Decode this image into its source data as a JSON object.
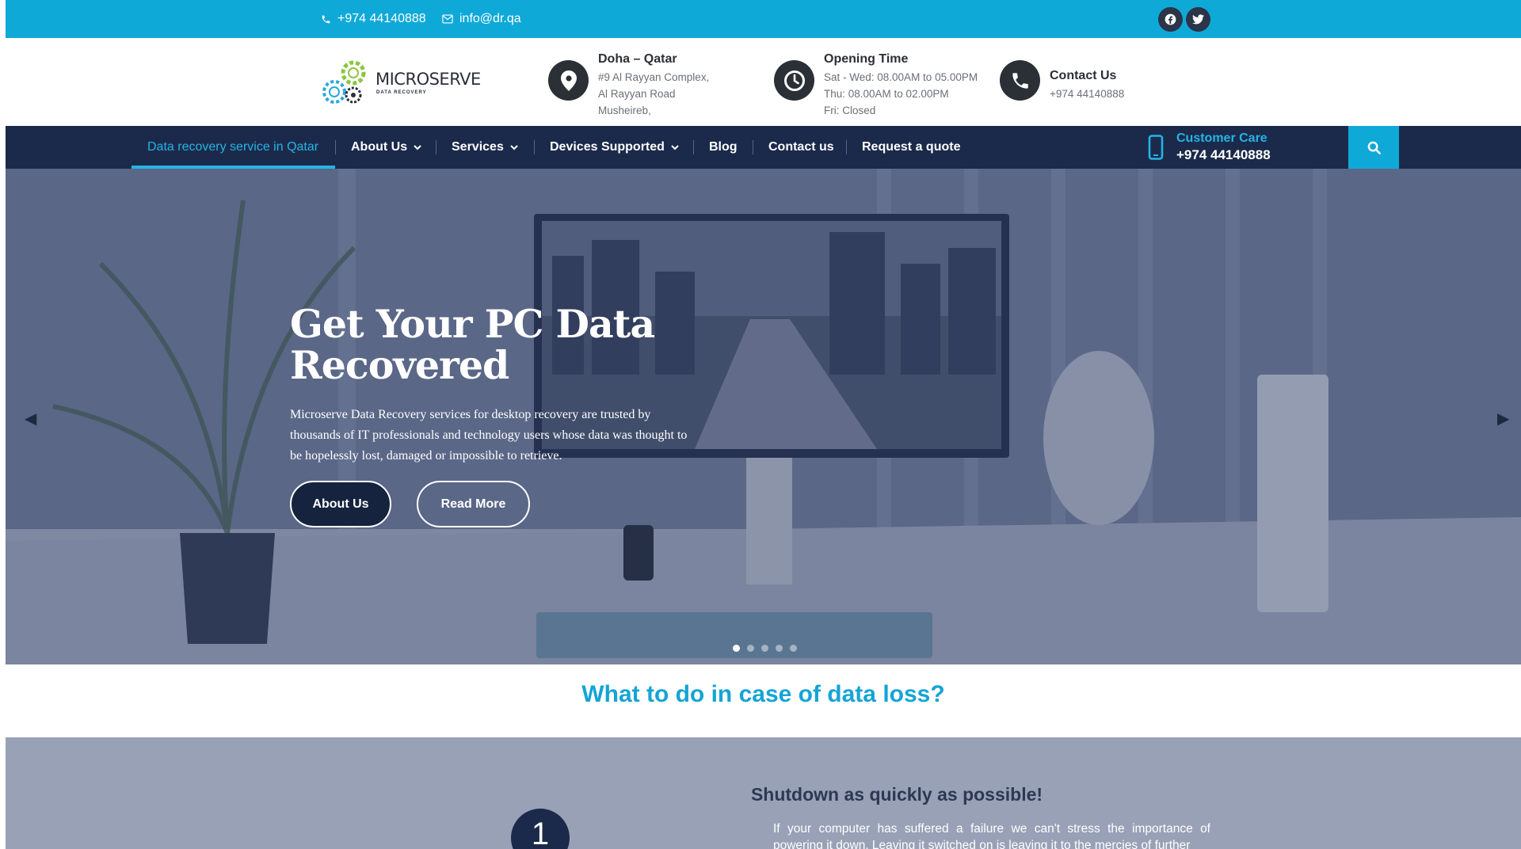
{
  "topbar": {
    "phone": "+974 44140888",
    "email": "info@dr.qa",
    "social": [
      "facebook-icon",
      "twitter-icon"
    ]
  },
  "header": {
    "logo_text": "MICROSERVE",
    "logo_sub": "DATA RECOVERY",
    "location": {
      "title": "Doha – Qatar",
      "line1": "#9 Al Rayyan Complex,",
      "line2": "Al Rayyan Road",
      "line3": "Musheireb,"
    },
    "hours": {
      "title": "Opening Time",
      "line1": "Sat - Wed: 08.00AM to 05.00PM",
      "line2": "Thu: 08.00AM to 02.00PM",
      "line3": "Fri: Closed"
    },
    "contact": {
      "title": "Contact Us",
      "phone": "+974 44140888"
    }
  },
  "nav": {
    "items": [
      {
        "label": "Data recovery service in Qatar",
        "active": true
      },
      {
        "label": "About Us",
        "dropdown": true
      },
      {
        "label": "Services",
        "dropdown": true
      },
      {
        "label": "Devices Supported",
        "dropdown": true
      },
      {
        "label": "Blog"
      },
      {
        "label": "Contact us"
      },
      {
        "label": "Request a quote"
      }
    ],
    "customer_care_label": "Customer Care",
    "customer_care_phone": "+974 44140888"
  },
  "hero": {
    "title": "Get Your PC Data Recovered",
    "text": "Microserve Data Recovery services for desktop recovery are trusted by thousands of IT professionals and technology users whose data was thought to be hopelessly lost, damaged or impossible to retrieve.",
    "btn_about": "About Us",
    "btn_read": "Read More",
    "slides_total": 5,
    "slide_active": 1
  },
  "section": {
    "title": "What to do in case of data loss?",
    "step_number": "1",
    "step_title": "Shutdown as quickly as possible!",
    "step_text": "If your computer has suffered a failure we can't stress the importance of powering it down. Leaving it switched on is leaving it to the mercies of further"
  },
  "colors": {
    "accent": "#0fa9d8",
    "nav_bg": "#1b2a4a",
    "title_blue": "#14a4d6"
  }
}
